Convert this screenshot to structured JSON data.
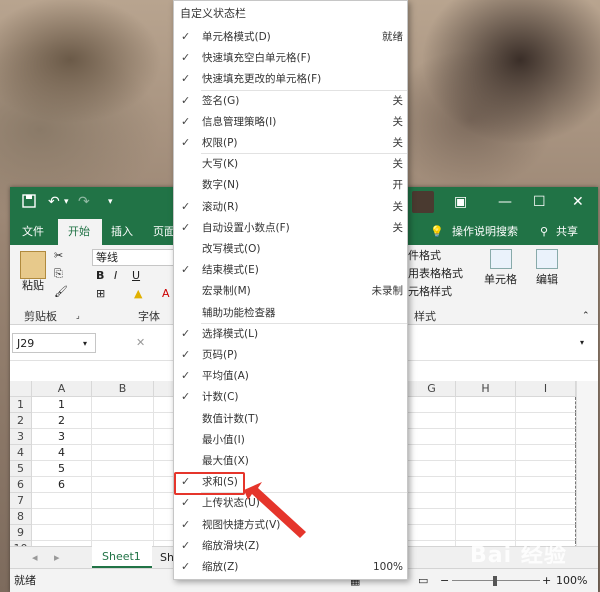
{
  "menu": {
    "title": "自定义状态栏",
    "items": [
      {
        "label": "单元格模式(D)",
        "value": "就绪",
        "checked": true
      },
      {
        "label": "快速填充空白单元格(F)",
        "value": "",
        "checked": true
      },
      {
        "label": "快速填充更改的单元格(F)",
        "value": "",
        "checked": true
      },
      {
        "label": "签名(G)",
        "value": "关",
        "checked": true
      },
      {
        "label": "信息管理策略(I)",
        "value": "关",
        "checked": true
      },
      {
        "label": "权限(P)",
        "value": "关",
        "checked": true
      },
      {
        "label": "大写(K)",
        "value": "关",
        "checked": false
      },
      {
        "label": "数字(N)",
        "value": "开",
        "checked": false
      },
      {
        "label": "滚动(R)",
        "value": "关",
        "checked": true
      },
      {
        "label": "自动设置小数点(F)",
        "value": "关",
        "checked": true
      },
      {
        "label": "改写模式(O)",
        "value": "",
        "checked": false
      },
      {
        "label": "结束模式(E)",
        "value": "",
        "checked": true
      },
      {
        "label": "宏录制(M)",
        "value": "未录制",
        "checked": false
      },
      {
        "label": "辅助功能检查器",
        "value": "",
        "checked": false
      },
      {
        "label": "选择模式(L)",
        "value": "",
        "checked": true
      },
      {
        "label": "页码(P)",
        "value": "",
        "checked": true
      },
      {
        "label": "平均值(A)",
        "value": "",
        "checked": true
      },
      {
        "label": "计数(C)",
        "value": "",
        "checked": true
      },
      {
        "label": "数值计数(T)",
        "value": "",
        "checked": false
      },
      {
        "label": "最小值(I)",
        "value": "",
        "checked": false
      },
      {
        "label": "最大值(X)",
        "value": "",
        "checked": false
      },
      {
        "label": "求和(S)",
        "value": "",
        "checked": true
      },
      {
        "label": "上传状态(U)",
        "value": "",
        "checked": true
      },
      {
        "label": "视图快捷方式(V)",
        "value": "",
        "checked": true
      },
      {
        "label": "缩放滑块(Z)",
        "value": "",
        "checked": true
      },
      {
        "label": "缩放(Z)",
        "value": "100%",
        "checked": true
      }
    ]
  },
  "excel": {
    "tabs": {
      "file": "文件",
      "home": "开始",
      "insert": "插入",
      "page": "页面",
      "search": "操作说明搜索",
      "share": "共享"
    },
    "ribbon": {
      "clipboard": "剪贴板",
      "paste": "粘贴",
      "font_group": "字体",
      "font_name": "等线",
      "bold": "B",
      "italic": "I",
      "underline": "U",
      "cond_format": "件格式",
      "table_format": "用表格格式",
      "cell_style": "元格样式",
      "styles_group": "样式",
      "cells": "单元格",
      "editing": "编辑"
    },
    "name_box": "J29",
    "columns": [
      "A",
      "B",
      "G",
      "H",
      "I"
    ],
    "rows": [
      "1",
      "2",
      "3",
      "4",
      "5",
      "6",
      "7",
      "8",
      "9",
      "10"
    ],
    "col_a_values": [
      "1",
      "2",
      "3",
      "4",
      "5",
      "6"
    ],
    "sheet_tab": "Sheet1",
    "sheet_tab_partial": "Sh",
    "status_ready": "就绪",
    "zoom": "100%"
  },
  "watermark": "Bai 经验"
}
